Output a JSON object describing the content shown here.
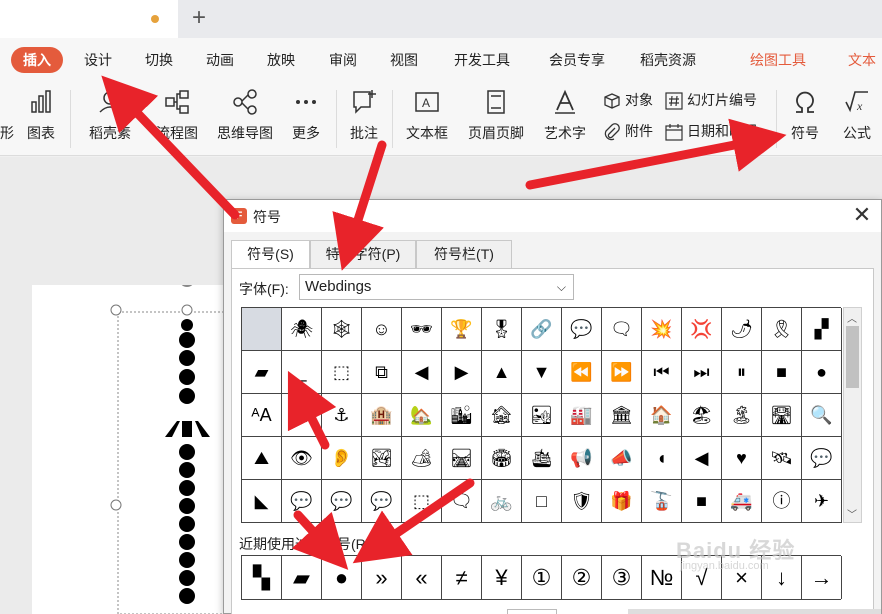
{
  "tabbar": {
    "new_tab": "+"
  },
  "menu": {
    "items": [
      "插入",
      "设计",
      "切换",
      "动画",
      "放映",
      "审阅",
      "视图",
      "开发工具",
      "会员专享",
      "稻壳资源",
      "绘图工具",
      "文本"
    ]
  },
  "toolbar": {
    "chart_prefix": "形",
    "chart": "图表",
    "daoke": "稻壳素",
    "flowchart": "流程图",
    "mindmap": "思维导图",
    "more": "更多",
    "comment": "批注",
    "textbox": "文本框",
    "header_footer": "页眉页脚",
    "wordart": "艺术字",
    "object": "对象",
    "slide_number": "幻灯片编号",
    "attachment": "附件",
    "datetime": "日期和时间",
    "symbol": "符号",
    "formula": "公式"
  },
  "dialog": {
    "logo": "F",
    "title": "符号",
    "close": "✕",
    "tabs": [
      "符号(S)",
      "特殊字符(P)",
      "符号栏(T)"
    ],
    "font_label": "字体(F):",
    "font_value": "Webdings",
    "recent_label": "近期使用过的符号(R):"
  },
  "symbol_grid": [
    [
      "",
      "🕷",
      "🕸",
      "☺",
      "🕶",
      "🏆",
      "🎖",
      "🔗",
      "💬",
      "🗨",
      "💥",
      "💢",
      "🌶",
      "🎗",
      "▞"
    ],
    [
      "▰",
      "_",
      "⬚",
      "⧉",
      "◀",
      "▶",
      "▲",
      "▼",
      "⏪",
      "⏩",
      "⏮",
      "⏭",
      "⏸",
      "■",
      "●"
    ],
    [
      "ᴬA",
      "🗨",
      "⚓",
      "🏨",
      "🏡",
      "🏙",
      "🏚",
      "🏜",
      "🏭",
      "🏛",
      "🏠",
      "🏖",
      "🏝",
      "🛣",
      "🔍"
    ],
    [
      "⛰",
      "👁",
      "👂",
      "🏞",
      "🏕",
      "🛤",
      "🏟",
      "🛳",
      "📢",
      "📣",
      "◖",
      "◀",
      "♥",
      "🛰",
      "💬"
    ],
    [
      "◣",
      "💬",
      "💬",
      "💬",
      "⬚",
      "🗨",
      "🚲",
      "□",
      "🛡",
      "🎁",
      "🚡",
      "■",
      "🚑",
      "ⓘ",
      "✈"
    ]
  ],
  "recent_symbols": [
    "▚",
    "▰",
    "●",
    "»",
    "«",
    "≠",
    "¥",
    "①",
    "②",
    "③",
    "№",
    "√",
    "×",
    "↓",
    "→"
  ],
  "watermark": {
    "main": "Baidu 经验",
    "sub": "jingyan.baidu.com"
  },
  "colors": {
    "accent": "#e45b3c",
    "arrow": "#e8232a"
  }
}
